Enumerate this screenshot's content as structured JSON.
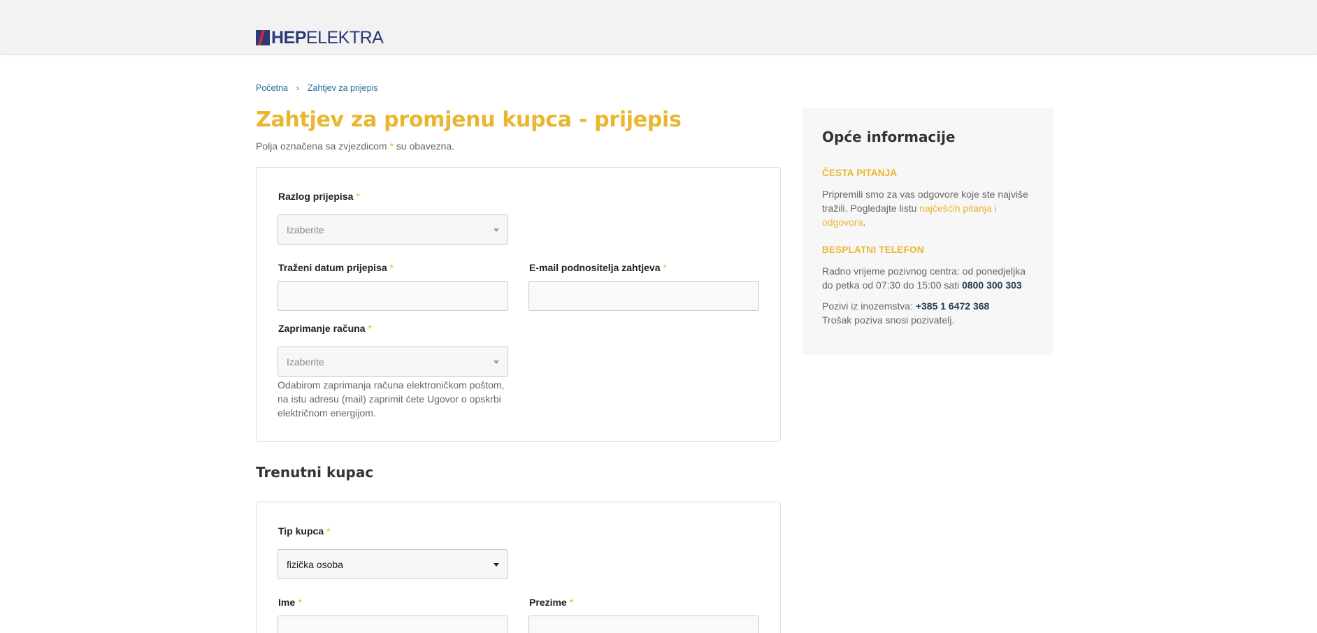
{
  "header": {
    "logo_hep": "HEP",
    "logo_elektra": "ELEKTRA"
  },
  "breadcrumb": {
    "home": "Početna",
    "current": "Zahtjev za prijepis"
  },
  "page": {
    "title": "Zahtjev za promjenu kupca - prijepis",
    "required_note_before": "Polja označena sa zvjezdicom",
    "required_star": "*",
    "required_note_after": "su obavezna."
  },
  "form": {
    "reason_label": "Razlog prijepisa",
    "reason_placeholder": "Izaberite",
    "date_label": "Traženi datum prijepisa",
    "date_value": "",
    "email_label": "E-mail podnositelja zahtjeva",
    "email_value": "",
    "invoice_label": "Zaprimanje računa",
    "invoice_placeholder": "Izaberite",
    "invoice_help": "Odabirom zaprimanja računa elektroničkom poštom, na istu adresu (mail) zaprimit ćete Ugovor o opskrbi električnom energijom."
  },
  "current_customer": {
    "section_title": "Trenutni kupac",
    "type_label": "Tip kupca",
    "type_value": "fizička osoba",
    "first_name_label": "Ime",
    "first_name_value": "",
    "last_name_label": "Prezime",
    "last_name_value": ""
  },
  "sidebar": {
    "title": "Opće informacije",
    "faq_heading": "ČESTA PITANJA",
    "faq_text": "Pripremili smo za vas odgovore koje ste najviše tražili. Pogledajte listu",
    "faq_link": "najčešćih pitanja i odgovora",
    "faq_end": ".",
    "phone_heading": "BESPLATNI TELEFON",
    "phone_text": "Radno vrijeme pozivnog centra: od ponedjeljka do petka od 07:30 do 15:00 sati",
    "phone_number": "0800 300 303",
    "intl_text": "Pozivi iz inozemstva:",
    "intl_number": "+385 1 6472 368",
    "cost_text": "Trošak poziva snosi pozivatelj."
  },
  "colors": {
    "accent": "#e8b630",
    "brand": "#2a3a78",
    "logo_red": "#d7262e",
    "link": "#1a6f9a"
  }
}
